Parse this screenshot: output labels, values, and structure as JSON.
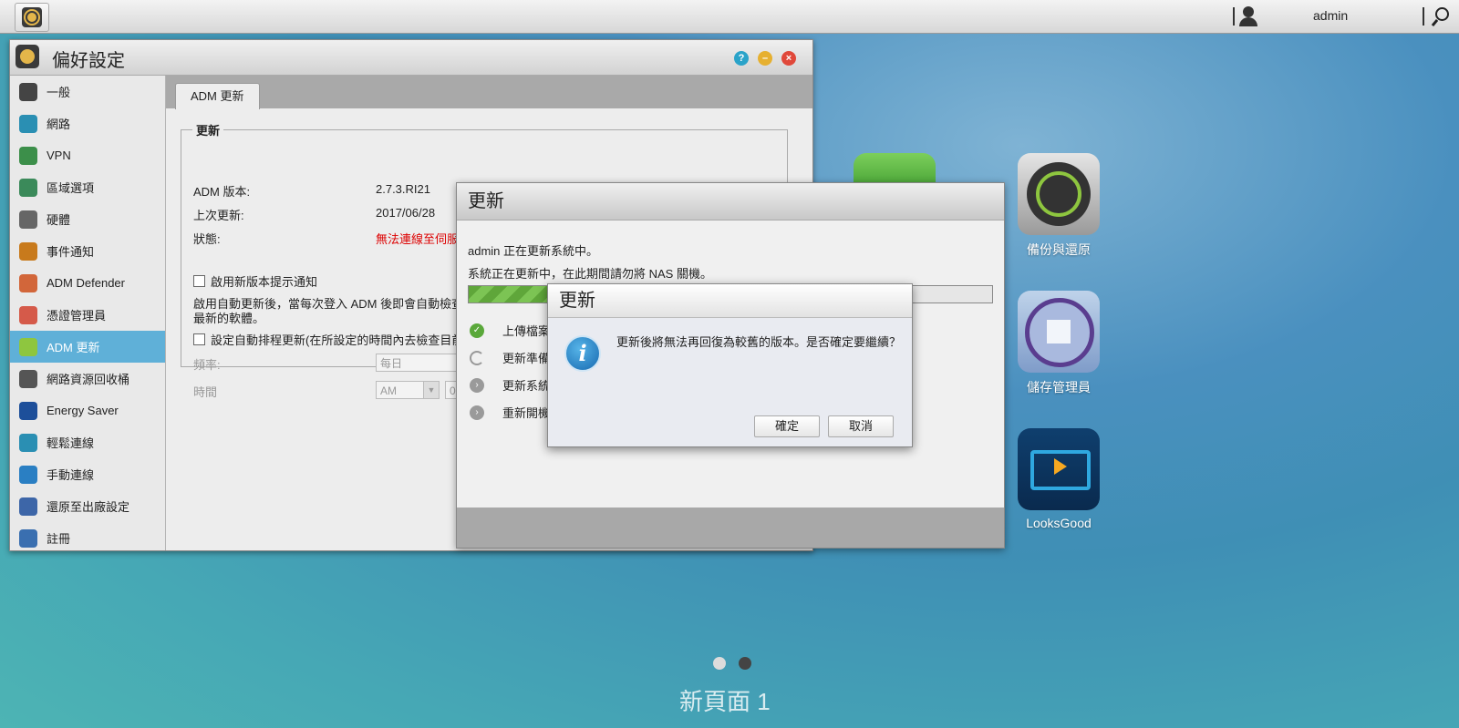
{
  "topbar": {
    "username": "admin"
  },
  "preferences": {
    "title": "偏好設定",
    "sidebar": [
      {
        "label": "一般",
        "icon": "server-icon",
        "color": "#444444"
      },
      {
        "label": "網路",
        "icon": "globe-icon",
        "color": "#2a8fb3"
      },
      {
        "label": "VPN",
        "icon": "vpn-house-icon",
        "color": "#3c8f4a"
      },
      {
        "label": "區域選項",
        "icon": "region-globe-icon",
        "color": "#3b8a5a"
      },
      {
        "label": "硬體",
        "icon": "hardware-disk-icon",
        "color": "#666666"
      },
      {
        "label": "事件通知",
        "icon": "alert-icon",
        "color": "#c87a1c"
      },
      {
        "label": "ADM Defender",
        "icon": "firewall-icon",
        "color": "#d2663a"
      },
      {
        "label": "憑證管理員",
        "icon": "certificate-icon",
        "color": "#d55a4a"
      },
      {
        "label": "ADM 更新",
        "icon": "update-arrow-icon",
        "color": "#8ec63f"
      },
      {
        "label": "網路資源回收桶",
        "icon": "recycle-bin-icon",
        "color": "#555555"
      },
      {
        "label": "Energy Saver",
        "icon": "energy-icon",
        "color": "#1d4f9a"
      },
      {
        "label": "輕鬆連線",
        "icon": "cloud-connect-icon",
        "color": "#2a8fb3"
      },
      {
        "label": "手動連線",
        "icon": "manual-connect-icon",
        "color": "#2a7fc3"
      },
      {
        "label": "還原至出廠設定",
        "icon": "restore-icon",
        "color": "#3d66a8"
      },
      {
        "label": "註冊",
        "icon": "register-icon",
        "color": "#3a6fb0"
      }
    ],
    "tab": "ADM 更新",
    "group_title": "更新",
    "adm_version_label": "ADM 版本:",
    "adm_version_value": "2.7.3.RI21",
    "last_update_label": "上次更新:",
    "last_update_value": "2017/06/28",
    "status_label": "狀態:",
    "status_value": "無法連線至伺服器",
    "enable_notify_label": "啟用新版本提示通知",
    "auto_update_desc_1": "啟用自動更新後，當每次登入 ADM 後即會自動檢查並",
    "auto_update_desc_2": "最新的軟體。",
    "schedule_label": "設定自動排程更新(在所設定的時間內去檢查目前是",
    "frequency_label": "頻率:",
    "frequency_value": "每日",
    "time_label": "時間",
    "time_ampm": "AM",
    "time_hour": "0"
  },
  "update_window": {
    "title": "更新",
    "line1": "admin 正在更新系統中。",
    "line2": "系統正在更新中，在此期間請勿將 NAS 關機。",
    "progress": 0.15,
    "steps": [
      {
        "label": "上傳檔案",
        "state": "done"
      },
      {
        "label": "更新準備",
        "state": "loading"
      },
      {
        "label": "更新系統",
        "state": "pending"
      },
      {
        "label": "重新開機",
        "state": "pending"
      }
    ]
  },
  "dialog": {
    "title": "更新",
    "message": "更新後將無法再回復為較舊的版本。是否確定要繼續？",
    "ok": "確定",
    "cancel": "取消"
  },
  "desktop_icons": [
    {
      "label": "備份與還原",
      "icon": "backup-restore-icon"
    },
    {
      "label": "儲存管理員",
      "icon": "storage-manager-icon"
    },
    {
      "label": "LooksGood",
      "icon": "looksgood-icon"
    }
  ],
  "desktop_page_label": "新頁面 1"
}
